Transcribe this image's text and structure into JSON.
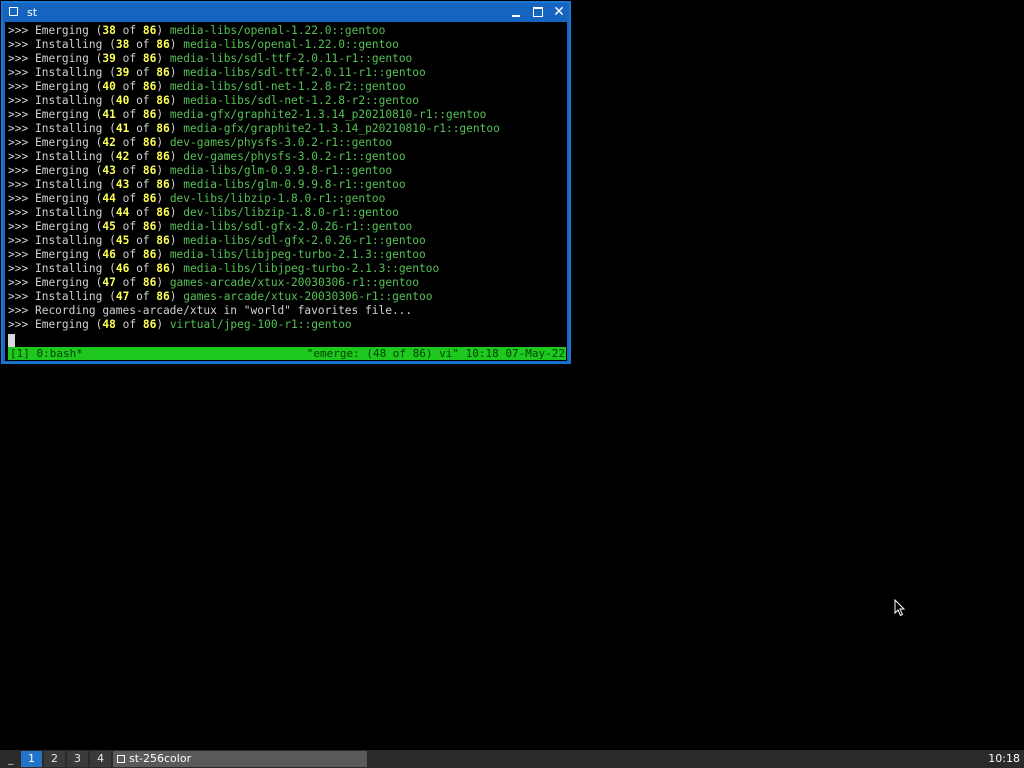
{
  "window": {
    "title": "st",
    "minimize_label": "_",
    "maximize_label": "□",
    "close_label": "✕"
  },
  "terminal": {
    "lines": [
      {
        "prompt": ">>>",
        "action": "Emerging",
        "open": "(",
        "current": "38",
        "of": "of",
        "total": "86",
        "close": ")",
        "package": "media-libs/openal-1.22.0::gentoo"
      },
      {
        "prompt": ">>>",
        "action": "Installing",
        "open": "(",
        "current": "38",
        "of": "of",
        "total": "86",
        "close": ")",
        "package": "media-libs/openal-1.22.0::gentoo"
      },
      {
        "prompt": ">>>",
        "action": "Emerging",
        "open": "(",
        "current": "39",
        "of": "of",
        "total": "86",
        "close": ")",
        "package": "media-libs/sdl-ttf-2.0.11-r1::gentoo"
      },
      {
        "prompt": ">>>",
        "action": "Installing",
        "open": "(",
        "current": "39",
        "of": "of",
        "total": "86",
        "close": ")",
        "package": "media-libs/sdl-ttf-2.0.11-r1::gentoo"
      },
      {
        "prompt": ">>>",
        "action": "Emerging",
        "open": "(",
        "current": "40",
        "of": "of",
        "total": "86",
        "close": ")",
        "package": "media-libs/sdl-net-1.2.8-r2::gentoo"
      },
      {
        "prompt": ">>>",
        "action": "Installing",
        "open": "(",
        "current": "40",
        "of": "of",
        "total": "86",
        "close": ")",
        "package": "media-libs/sdl-net-1.2.8-r2::gentoo"
      },
      {
        "prompt": ">>>",
        "action": "Emerging",
        "open": "(",
        "current": "41",
        "of": "of",
        "total": "86",
        "close": ")",
        "package": "media-gfx/graphite2-1.3.14_p20210810-r1::gentoo"
      },
      {
        "prompt": ">>>",
        "action": "Installing",
        "open": "(",
        "current": "41",
        "of": "of",
        "total": "86",
        "close": ")",
        "package": "media-gfx/graphite2-1.3.14_p20210810-r1::gentoo"
      },
      {
        "prompt": ">>>",
        "action": "Emerging",
        "open": "(",
        "current": "42",
        "of": "of",
        "total": "86",
        "close": ")",
        "package": "dev-games/physfs-3.0.2-r1::gentoo"
      },
      {
        "prompt": ">>>",
        "action": "Installing",
        "open": "(",
        "current": "42",
        "of": "of",
        "total": "86",
        "close": ")",
        "package": "dev-games/physfs-3.0.2-r1::gentoo"
      },
      {
        "prompt": ">>>",
        "action": "Emerging",
        "open": "(",
        "current": "43",
        "of": "of",
        "total": "86",
        "close": ")",
        "package": "media-libs/glm-0.9.9.8-r1::gentoo"
      },
      {
        "prompt": ">>>",
        "action": "Installing",
        "open": "(",
        "current": "43",
        "of": "of",
        "total": "86",
        "close": ")",
        "package": "media-libs/glm-0.9.9.8-r1::gentoo"
      },
      {
        "prompt": ">>>",
        "action": "Emerging",
        "open": "(",
        "current": "44",
        "of": "of",
        "total": "86",
        "close": ")",
        "package": "dev-libs/libzip-1.8.0-r1::gentoo"
      },
      {
        "prompt": ">>>",
        "action": "Installing",
        "open": "(",
        "current": "44",
        "of": "of",
        "total": "86",
        "close": ")",
        "package": "dev-libs/libzip-1.8.0-r1::gentoo"
      },
      {
        "prompt": ">>>",
        "action": "Emerging",
        "open": "(",
        "current": "45",
        "of": "of",
        "total": "86",
        "close": ")",
        "package": "media-libs/sdl-gfx-2.0.26-r1::gentoo"
      },
      {
        "prompt": ">>>",
        "action": "Installing",
        "open": "(",
        "current": "45",
        "of": "of",
        "total": "86",
        "close": ")",
        "package": "media-libs/sdl-gfx-2.0.26-r1::gentoo"
      },
      {
        "prompt": ">>>",
        "action": "Emerging",
        "open": "(",
        "current": "46",
        "of": "of",
        "total": "86",
        "close": ")",
        "package": "media-libs/libjpeg-turbo-2.1.3::gentoo"
      },
      {
        "prompt": ">>>",
        "action": "Installing",
        "open": "(",
        "current": "46",
        "of": "of",
        "total": "86",
        "close": ")",
        "package": "media-libs/libjpeg-turbo-2.1.3::gentoo"
      },
      {
        "prompt": ">>>",
        "action": "Emerging",
        "open": "(",
        "current": "47",
        "of": "of",
        "total": "86",
        "close": ")",
        "package": "games-arcade/xtux-20030306-r1::gentoo"
      },
      {
        "prompt": ">>>",
        "action": "Installing",
        "open": "(",
        "current": "47",
        "of": "of",
        "total": "86",
        "close": ")",
        "package": "games-arcade/xtux-20030306-r1::gentoo"
      },
      {
        "prompt": ">>>",
        "action": "Recording games-arcade/xtux in \"world\" favorites file...",
        "open": "",
        "current": "",
        "of": "",
        "total": "",
        "close": "",
        "package": ""
      },
      {
        "prompt": ">>>",
        "action": "Emerging",
        "open": "(",
        "current": "48",
        "of": "of",
        "total": "86",
        "close": ")",
        "package": "virtual/jpeg-100-r1::gentoo"
      }
    ]
  },
  "tmux_status": {
    "left": "[1] 0:bash*",
    "right": "\"emerge: (48 of 86) vi\" 10:18 07-May-22"
  },
  "taskbar": {
    "separator": "_",
    "workspaces": [
      "1",
      "2",
      "3",
      "4"
    ],
    "active_workspace": "1",
    "task_label": "st-256color",
    "clock": "10:18"
  },
  "colors": {
    "titlebar": "#1565c0",
    "tmux_status": "#1ec81e",
    "counter": "#ffff55",
    "package": "#55c055"
  }
}
